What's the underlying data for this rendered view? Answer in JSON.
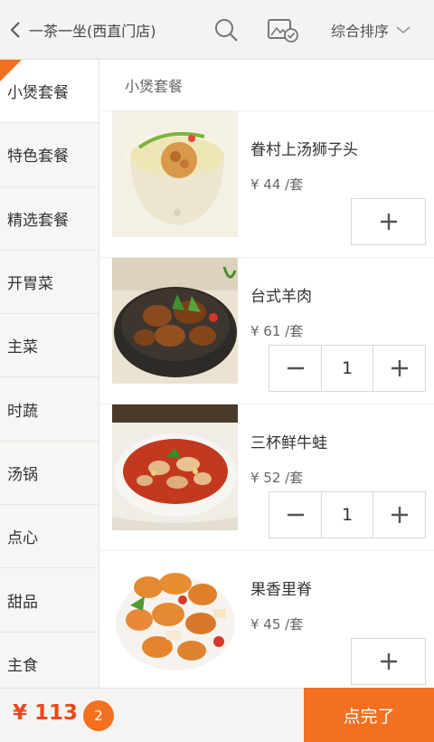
{
  "header": {
    "store_name": "一茶一坐(西直门店)",
    "sort_label": "综合排序"
  },
  "categories": [
    {
      "label": "小煲套餐",
      "active": true
    },
    {
      "label": "特色套餐"
    },
    {
      "label": "精选套餐"
    },
    {
      "label": "开胃菜"
    },
    {
      "label": "主菜"
    },
    {
      "label": "时蔬"
    },
    {
      "label": "汤锅"
    },
    {
      "label": "点心"
    },
    {
      "label": "甜品"
    },
    {
      "label": "主食"
    }
  ],
  "section_title": "小煲套餐",
  "items": [
    {
      "name": "眷村上汤狮子头",
      "price": "¥ 44 /套",
      "quantity": null
    },
    {
      "name": "台式羊肉",
      "price": "¥ 61 /套",
      "quantity": "1"
    },
    {
      "name": "三杯鲜牛蛙",
      "price": "¥ 52 /套",
      "quantity": "1"
    },
    {
      "name": "果香里脊",
      "price": "¥ 45 /套",
      "quantity": null
    }
  ],
  "cart": {
    "total": "¥ 113",
    "count": "2",
    "submit_label": "点完了"
  },
  "colors": {
    "accent": "#f37021",
    "price_red": "#e8491d"
  }
}
